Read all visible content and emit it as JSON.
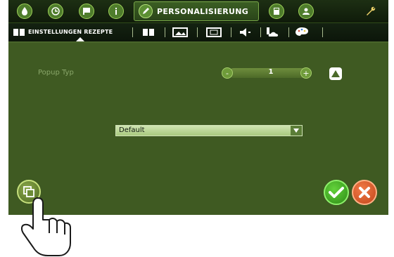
{
  "header": {
    "active_tab": "PERSONALISIERUNG",
    "icons": [
      "drop-icon",
      "clock-icon",
      "flag-icon",
      "info-icon",
      "pen-icon",
      "calculator-icon",
      "user-icon",
      "wrench-icon"
    ]
  },
  "subnav": {
    "active_label": "EINSTELLUNGEN REZEPTE",
    "icons": [
      "book-icon",
      "book-icon",
      "image-icon",
      "image-frame-icon",
      "speaker-icon",
      "weather-icon",
      "palette-icon"
    ]
  },
  "form": {
    "popup_label": "Popup Typ",
    "popup_value": "1",
    "minus_symbol": "-",
    "plus_symbol": "+",
    "dropdown_value": "Default"
  },
  "colors": {
    "background": "#3f5a22",
    "header": "#0f1b0a",
    "accent": "#9fd25a",
    "confirm": "#2d8c16",
    "cancel": "#c4461c"
  }
}
